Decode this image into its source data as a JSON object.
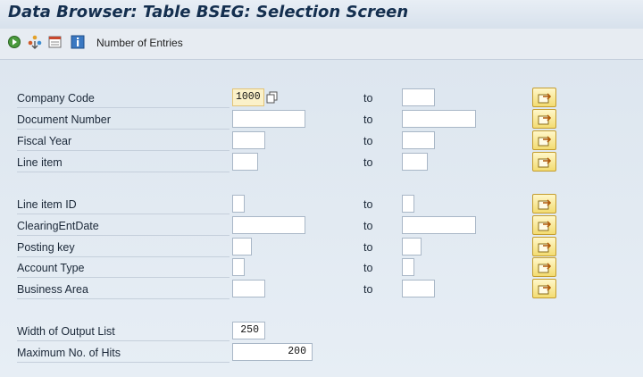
{
  "window": {
    "title": "Data Browser: Table BSEG: Selection Screen"
  },
  "toolbar": {
    "icons": [
      "execute-icon",
      "multiple-selection-icon",
      "delete-entry-icon",
      "info-icon"
    ],
    "number_of_entries_label": "Number of Entries"
  },
  "fields": [
    {
      "label": "Company Code",
      "from": "1000",
      "to": "",
      "to_text": "to"
    },
    {
      "label": "Document Number",
      "from": "",
      "to": "",
      "to_text": "to"
    },
    {
      "label": "Fiscal Year",
      "from": "",
      "to": "",
      "to_text": "to"
    },
    {
      "label": "Line item",
      "from": "",
      "to": "",
      "to_text": "to"
    },
    {
      "label": "Line item ID",
      "from": "",
      "to": "",
      "to_text": "to"
    },
    {
      "label": "ClearingEntDate",
      "from": "",
      "to": "",
      "to_text": "to"
    },
    {
      "label": "Posting key",
      "from": "",
      "to": "",
      "to_text": "to"
    },
    {
      "label": "Account Type",
      "from": "",
      "to": "",
      "to_text": "to"
    },
    {
      "label": "Business Area",
      "from": "",
      "to": "",
      "to_text": "to"
    }
  ],
  "output": {
    "width_label": "Width of Output List",
    "width_value": "250",
    "max_hits_label": "Maximum No. of Hits",
    "max_hits_value": "200"
  },
  "colors": {
    "title": "#142f4f",
    "background": "#dfe7ef",
    "highlight_field": "#fbf1c9",
    "multi_button": "#f3dc72"
  }
}
